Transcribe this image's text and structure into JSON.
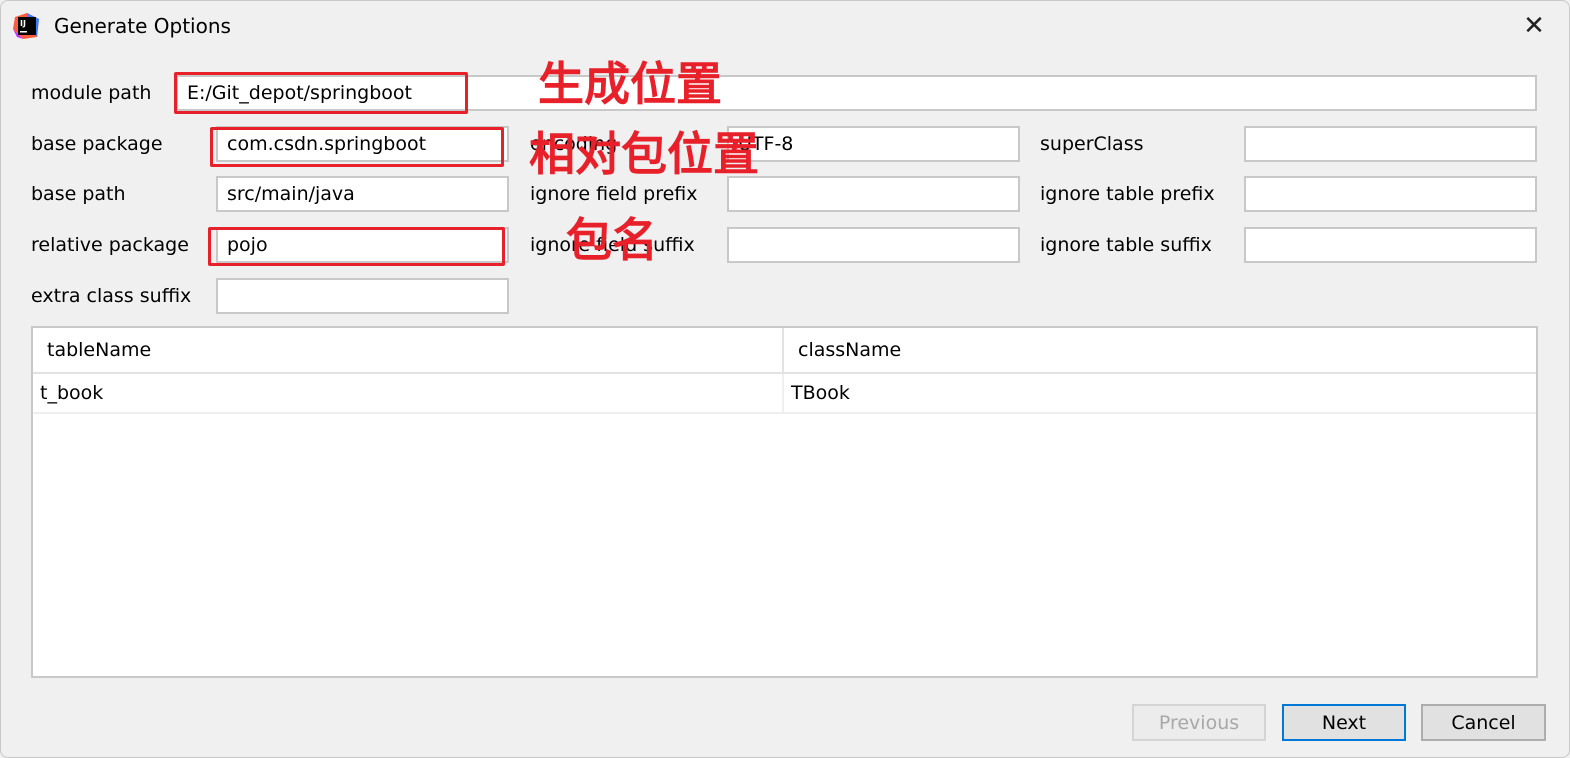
{
  "window": {
    "title": "Generate Options",
    "close_glyph": "✕"
  },
  "form": {
    "module_path": {
      "label": "module path",
      "value": "E:/Git_depot/springboot"
    },
    "base_package": {
      "label": "base package",
      "value": "com.csdn.springboot"
    },
    "encoding": {
      "label": "encoding",
      "value": "UTF-8"
    },
    "super_class": {
      "label": "superClass",
      "value": ""
    },
    "base_path": {
      "label": "base path",
      "value": "src/main/java"
    },
    "ignore_field_prefix": {
      "label": "ignore field prefix",
      "value": ""
    },
    "ignore_table_prefix": {
      "label": "ignore table prefix",
      "value": ""
    },
    "relative_package": {
      "label": "relative package",
      "value": "pojo"
    },
    "ignore_field_suffix": {
      "label": "ignore field suffix",
      "value": ""
    },
    "ignore_table_suffix": {
      "label": "ignore table suffix",
      "value": ""
    },
    "extra_class_suffix": {
      "label": "extra class suffix",
      "value": ""
    }
  },
  "table": {
    "columns": [
      "tableName",
      "className"
    ],
    "rows": [
      [
        "t_book",
        "TBook"
      ]
    ]
  },
  "buttons": {
    "previous": "Previous",
    "next": "Next",
    "cancel": "Cancel"
  },
  "annotations": {
    "module_path_note": "生成位置",
    "base_package_note": "相对包位置",
    "relative_package_note": "包名",
    "color": "#e8202a"
  }
}
